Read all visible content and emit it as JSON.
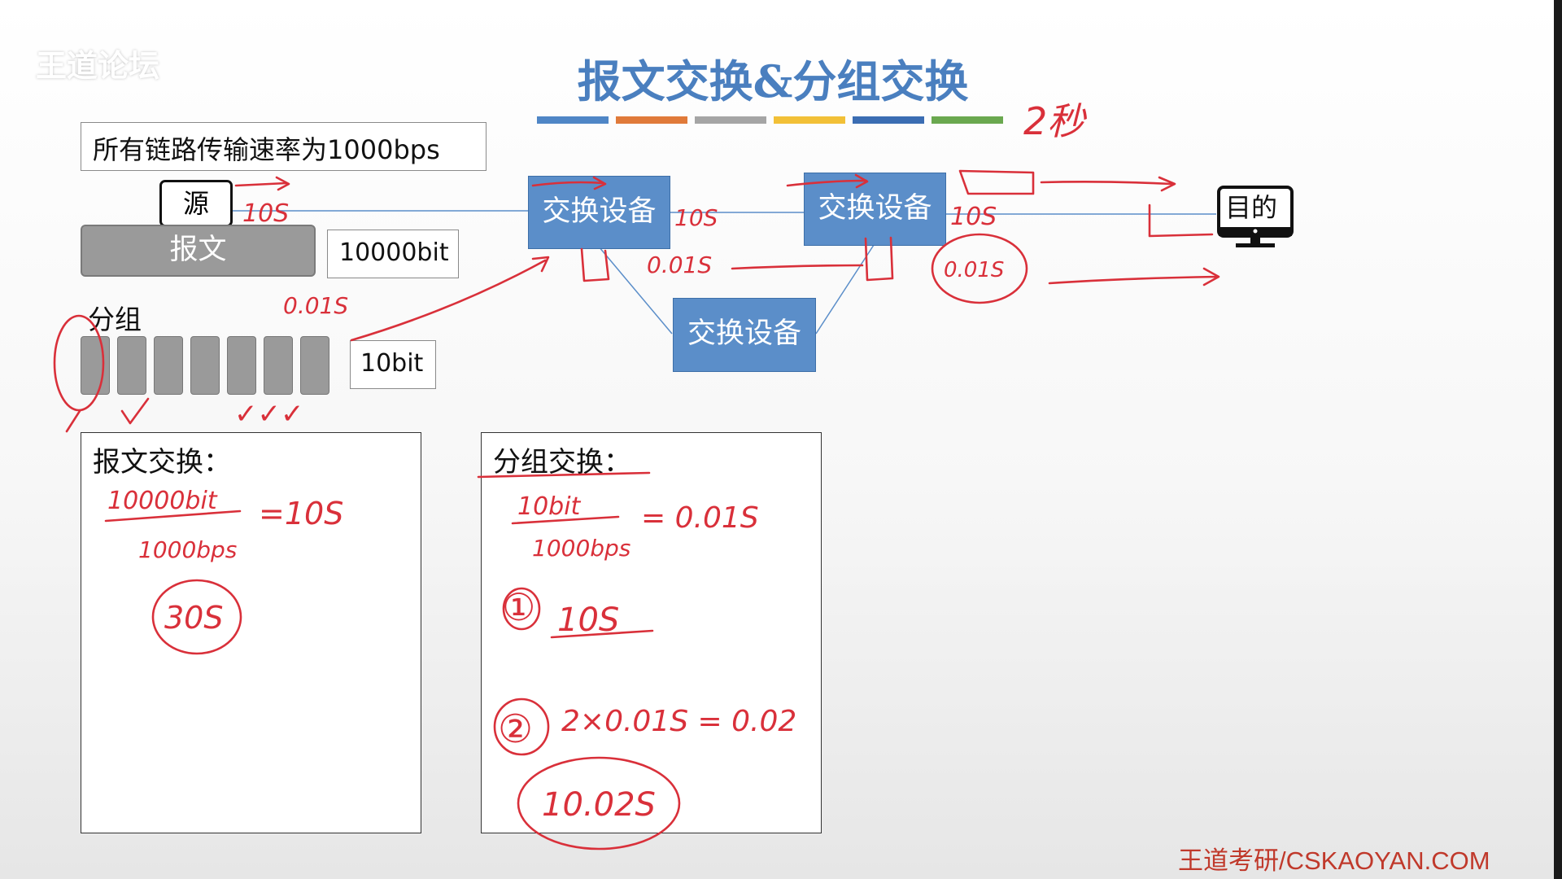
{
  "watermark": "王道论坛",
  "title": "报文交换&分组交换",
  "stripe_colors": [
    "#4f86c6",
    "#e07a3a",
    "#a5a5a5",
    "#f2c037",
    "#3b6db3",
    "#6aa84f"
  ],
  "link_rate_note": "所有链路传输速率为1000bps",
  "source_label": "源",
  "message_label": "报文",
  "message_size": "10000bit",
  "packets_label": "分组",
  "packet_size": "10bit",
  "switch_label": "交换设备",
  "dest_label": "目的",
  "message_switching_title": "报文交换：",
  "packet_switching_title": "分组交换：",
  "footer": "王道考研/CSKAOYAN.COM",
  "annotations": {
    "top_right": "2秒",
    "hop1": "10S",
    "hop2": "10S",
    "hop3": "10S",
    "p_delay_src": "0.01S",
    "p_delay_mid": "0.01S",
    "p_delay_right": "0.01S",
    "msg_fraction_num": "10000bit",
    "msg_fraction_den": "1000bps",
    "msg_result": "=10S",
    "msg_total": "30S",
    "pkt_fraction_num": "10bit",
    "pkt_fraction_den": "1000bps",
    "pkt_result": "= 0.01S",
    "pkt_step1_num": "①",
    "pkt_step1": "10S",
    "pkt_step2_num": "②",
    "pkt_step2": "2×0.01S = 0.02",
    "pkt_total": "10.02S",
    "checkmarks": "✓✓✓"
  },
  "ink_color": "#d9303a",
  "switch_color": "#5b8ec9"
}
